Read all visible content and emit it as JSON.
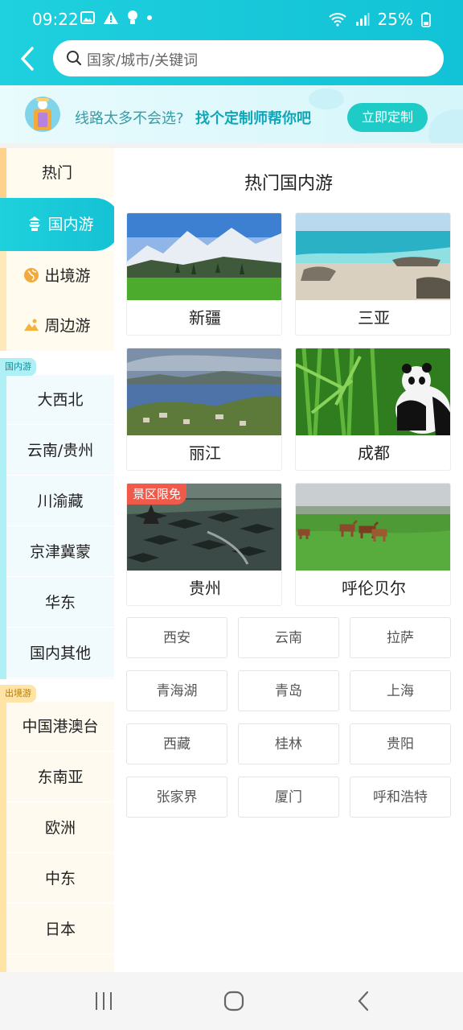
{
  "status_bar": {
    "time": "09:22",
    "battery": "25%"
  },
  "search": {
    "placeholder": "国家/城市/关键词"
  },
  "banner": {
    "text_prefix": "线路太多不会选?",
    "text_highlight": "找个定制师帮你吧",
    "button_label": "立即定制"
  },
  "sidebar": {
    "top_items": [
      {
        "label": "热门"
      },
      {
        "label": "国内游",
        "active": true
      },
      {
        "label": "出境游"
      },
      {
        "label": "周边游"
      }
    ],
    "domestic_section_label": "国内游",
    "domestic_items": [
      "大西北",
      "云南/贵州",
      "川渝藏",
      "京津冀蒙",
      "华东",
      "国内其他"
    ],
    "outbound_section_label": "出境游",
    "outbound_items": [
      "中国港澳台",
      "东南亚",
      "欧洲",
      "中东",
      "日本"
    ]
  },
  "content": {
    "title": "热门国内游",
    "cards": [
      {
        "name": "新疆",
        "image": "snowy-mountains-forest"
      },
      {
        "name": "三亚",
        "image": "tropical-beach"
      },
      {
        "name": "丽江",
        "image": "lake-town"
      },
      {
        "name": "成都",
        "image": "giant-panda-bamboo"
      },
      {
        "name": "贵州",
        "image": "miao-village-rooftops",
        "badge": "景区限免"
      },
      {
        "name": "呼伦贝尔",
        "image": "grassland-horses"
      }
    ],
    "tags": [
      "西安",
      "云南",
      "拉萨",
      "青海湖",
      "青岛",
      "上海",
      "西藏",
      "桂林",
      "贵阳",
      "张家界",
      "厦门",
      "呼和浩特"
    ]
  },
  "colors": {
    "accent": "#1fd0de",
    "cta": "#1fcbc6",
    "badge": "#f05a4a",
    "outbound": "#ffe4a6",
    "domestic": "#aef0f5"
  }
}
